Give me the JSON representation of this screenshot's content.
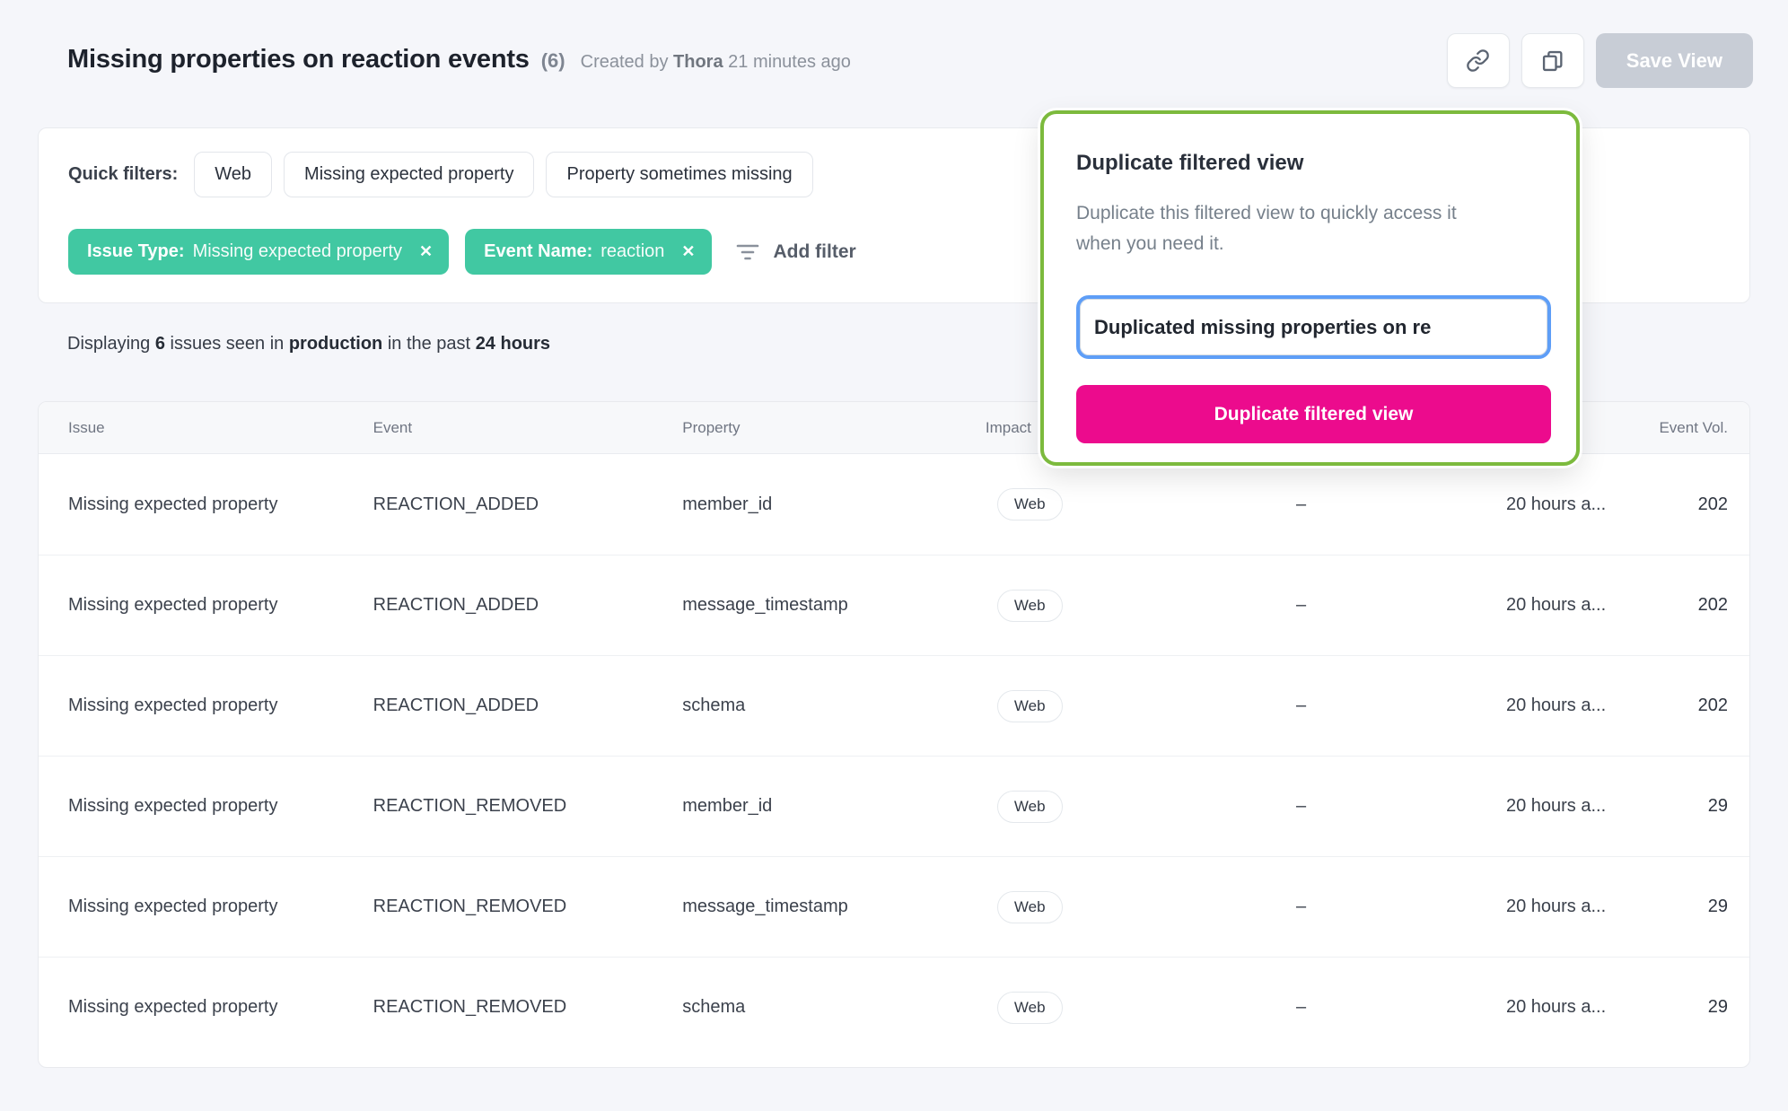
{
  "header": {
    "title": "Missing properties on reaction events",
    "count": "(6)",
    "created_by": "Created by",
    "author": "Thora",
    "time_ago": "21 minutes ago",
    "save_view": "Save View"
  },
  "quick_filters": {
    "label": "Quick filters:",
    "options": [
      "Web",
      "Missing expected property",
      "Property sometimes missing"
    ],
    "chips": [
      {
        "label": "Issue Type:",
        "value": "Missing expected property",
        "close": "✕"
      },
      {
        "label": "Event Name:",
        "value": "reaction",
        "close": "✕"
      }
    ],
    "add_filter": "Add filter"
  },
  "summary": {
    "t1": "Displaying",
    "b1": "6",
    "t2": "issues seen in",
    "b2": "production",
    "t3": "in the past",
    "b3": "24 hours"
  },
  "table": {
    "headers": {
      "issue": "Issue",
      "event": "Event",
      "property": "Property",
      "impact": "Impact",
      "dash": "",
      "time": "",
      "volume": "Event Vol."
    },
    "rows": [
      {
        "issue": "Missing expected property",
        "event": "REACTION_ADDED",
        "property": "member_id",
        "platform": "Web",
        "impact": "–",
        "time": "20 hours a...",
        "volume": "202"
      },
      {
        "issue": "Missing expected property",
        "event": "REACTION_ADDED",
        "property": "message_timestamp",
        "platform": "Web",
        "impact": "–",
        "time": "20 hours a...",
        "volume": "202"
      },
      {
        "issue": "Missing expected property",
        "event": "REACTION_ADDED",
        "property": "schema",
        "platform": "Web",
        "impact": "–",
        "time": "20 hours a...",
        "volume": "202"
      },
      {
        "issue": "Missing expected property",
        "event": "REACTION_REMOVED",
        "property": "member_id",
        "platform": "Web",
        "impact": "–",
        "time": "20 hours a...",
        "volume": "29"
      },
      {
        "issue": "Missing expected property",
        "event": "REACTION_REMOVED",
        "property": "message_timestamp",
        "platform": "Web",
        "impact": "–",
        "time": "20 hours a...",
        "volume": "29"
      },
      {
        "issue": "Missing expected property",
        "event": "REACTION_REMOVED",
        "property": "schema",
        "platform": "Web",
        "impact": "–",
        "time": "20 hours a...",
        "volume": "29"
      }
    ]
  },
  "popover": {
    "title": "Duplicate filtered view",
    "description": "Duplicate this filtered view to quickly access it when you need it.",
    "input_value": "Duplicated missing properties on re",
    "button": "Duplicate filtered view"
  },
  "colors": {
    "chip_green": "#41c8a2",
    "popover_border_green": "#7cba3d",
    "primary_pink": "#ec0b8d",
    "input_focus_blue": "#5e9ef7",
    "save_disabled_gray": "#c8cdd6",
    "page_bg": "#f5f6fa"
  }
}
